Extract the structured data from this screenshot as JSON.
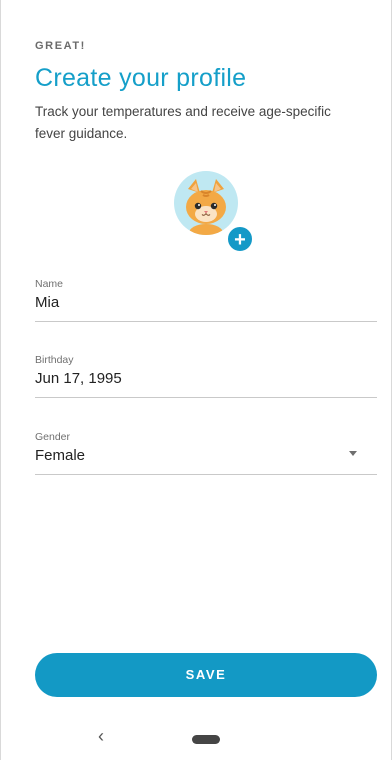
{
  "header": {
    "eyebrow": "GREAT!",
    "title": "Create your profile",
    "subtitle": "Track your temperatures and receive age-specific fever guidance."
  },
  "avatar": {
    "icon": "cat-avatar-icon",
    "add_label": "+"
  },
  "form": {
    "name": {
      "label": "Name",
      "value": "Mia"
    },
    "birthday": {
      "label": "Birthday",
      "value": "Jun 17, 1995"
    },
    "gender": {
      "label": "Gender",
      "value": "Female"
    }
  },
  "actions": {
    "save_label": "SAVE"
  },
  "navbar": {
    "back_glyph": "‹"
  },
  "colors": {
    "accent": "#159fc9",
    "button": "#1399c5",
    "avatar_bg": "#bfe8f2"
  }
}
